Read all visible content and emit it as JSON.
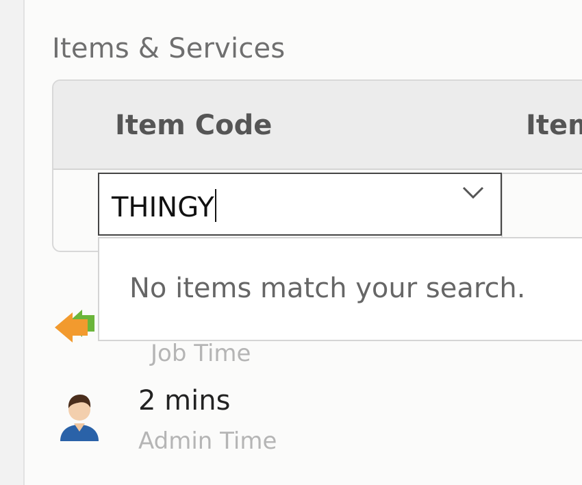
{
  "section": {
    "title": "Items & Services"
  },
  "table": {
    "columns": [
      "Item Code",
      "Item"
    ]
  },
  "item_code_field": {
    "value": "THINGY"
  },
  "dropdown": {
    "message": "No items match your search."
  },
  "job_time": {
    "label": "Job Time"
  },
  "admin_time": {
    "value": "2 mins",
    "label": "Admin Time"
  },
  "icons": {
    "chevron": "chevron-down-icon",
    "arrow": "swap-arrow-icon",
    "user": "user-avatar-icon"
  }
}
